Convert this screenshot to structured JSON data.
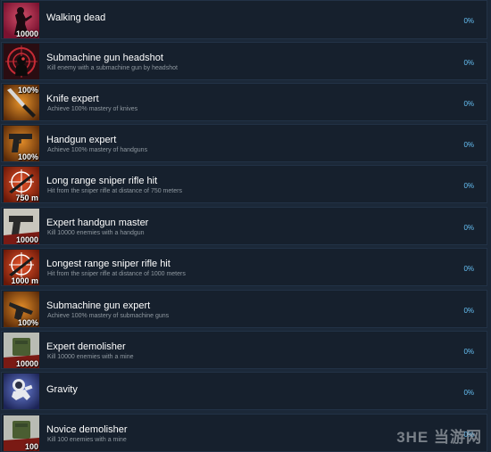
{
  "achievements": [
    {
      "title": "Walking dead",
      "description": "",
      "progress": "0%",
      "icon": "zombie-icon",
      "badge": "10000"
    },
    {
      "title": "Submachine gun headshot",
      "description": "Kill enemy with a submachine gun by headshot",
      "progress": "0%",
      "icon": "headshot-target-icon",
      "badge": ""
    },
    {
      "title": "Knife expert",
      "description": "Achieve 100% mastery of knives",
      "progress": "0%",
      "icon": "knife-icon",
      "badge": "100%"
    },
    {
      "title": "Handgun expert",
      "description": "Achieve 100% mastery of handguns",
      "progress": "0%",
      "icon": "handgun-icon",
      "badge": "100%"
    },
    {
      "title": "Long range sniper rifle hit",
      "description": "Hit from the sniper rifle at distance of 750 meters",
      "progress": "0%",
      "icon": "sniper-crosshair-icon",
      "badge": "750 m"
    },
    {
      "title": "Expert handgun master",
      "description": "Kill 10000 enemies with a handgun",
      "progress": "0%",
      "icon": "handgun-icon",
      "badge": "10000"
    },
    {
      "title": "Longest range sniper rifle hit",
      "description": "Hit from the sniper rifle at distance of 1000 meters",
      "progress": "0%",
      "icon": "sniper-crosshair-icon",
      "badge": "1000 m"
    },
    {
      "title": "Submachine gun expert",
      "description": "Achieve 100% mastery of submachine guns",
      "progress": "0%",
      "icon": "submachine-gun-icon",
      "badge": "100%"
    },
    {
      "title": "Expert demolisher",
      "description": "Kill 10000 enemies with a mine",
      "progress": "0%",
      "icon": "mine-icon",
      "badge": "10000"
    },
    {
      "title": "Gravity",
      "description": "",
      "progress": "0%",
      "icon": "astronaut-icon",
      "badge": ""
    },
    {
      "title": "Novice demolisher",
      "description": "Kill 100 enemies with a mine",
      "progress": "0%",
      "icon": "mine-icon",
      "badge": "100"
    }
  ],
  "watermark": "3HE 当游网",
  "colors": {
    "background": "#1b2838",
    "row": "#16202d",
    "border": "#223246",
    "progress": "#66c0f4",
    "description": "#8f98a0"
  }
}
